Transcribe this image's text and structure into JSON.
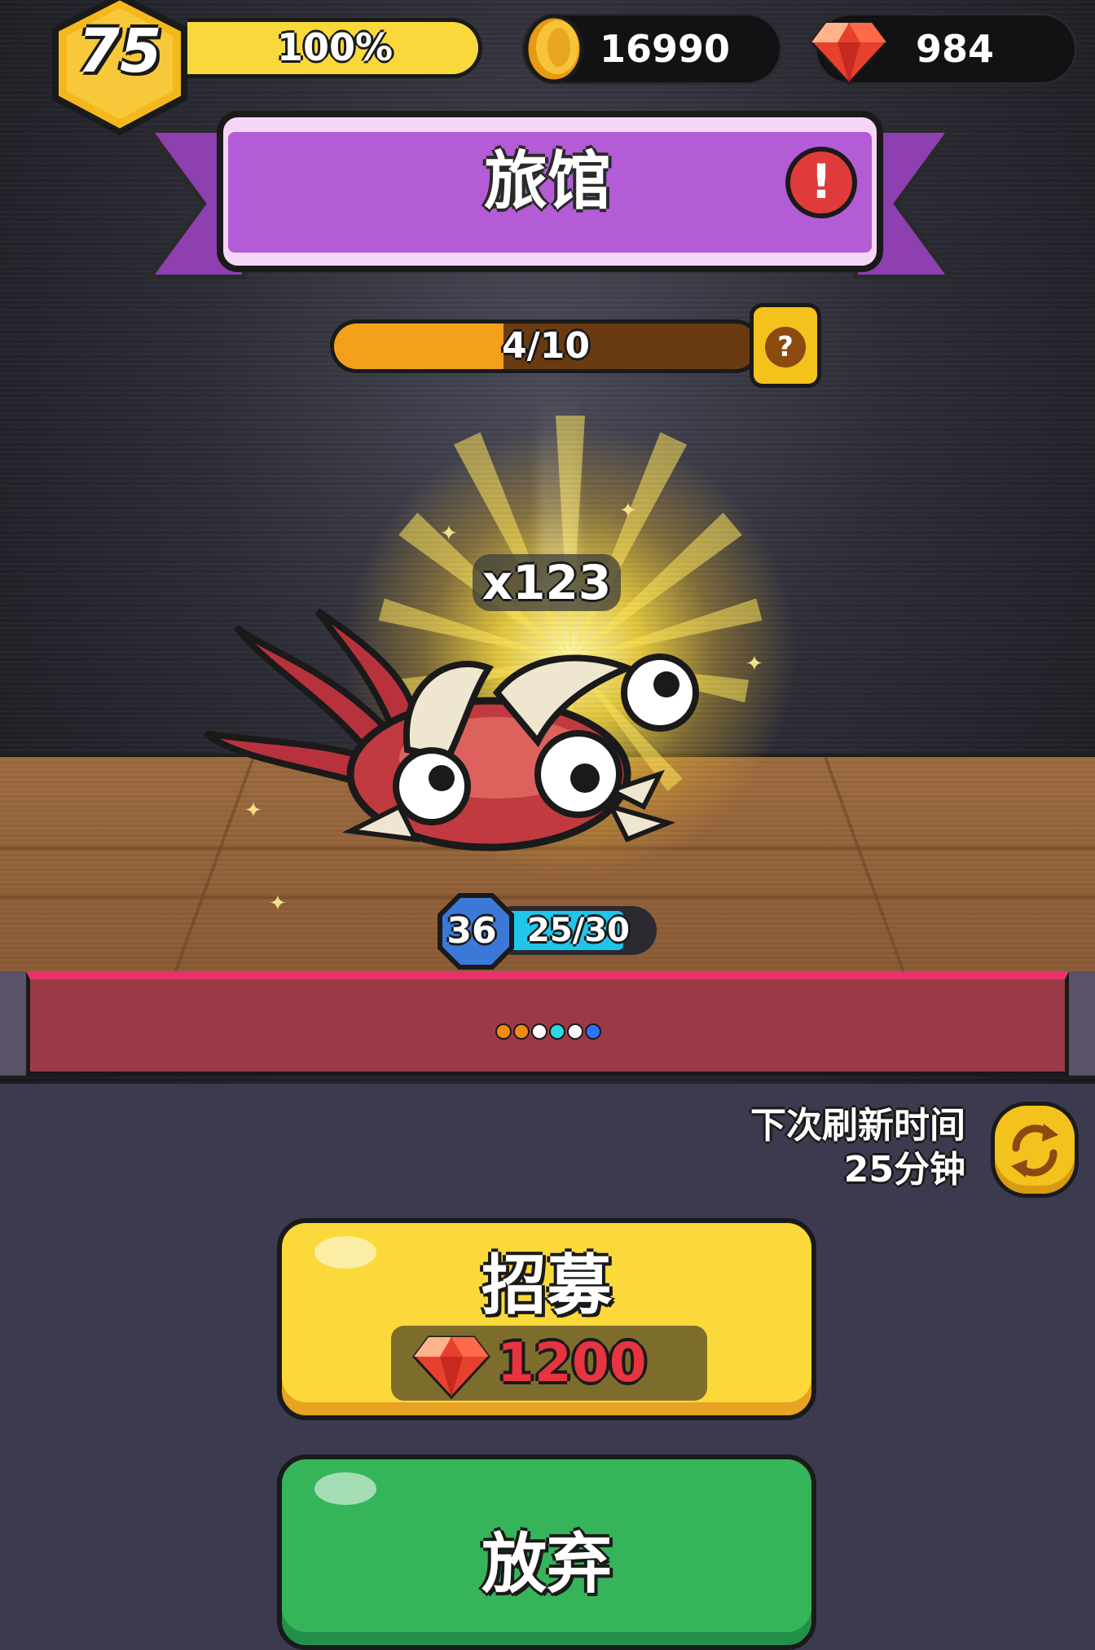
{
  "hud": {
    "player_level": "75",
    "xp_percent_label": "100%",
    "xp_fill": 1.0,
    "coins": "16990",
    "gems": "984",
    "icons": {
      "coin": "coin-icon",
      "gem": "gem-icon"
    }
  },
  "header": {
    "title": "旅馆",
    "alert_symbol": "!"
  },
  "progress": {
    "label": "4/10",
    "current": 4,
    "max": 10,
    "help_symbol": "?"
  },
  "unit": {
    "count_label": "x123",
    "level": "36",
    "hp_label": "25/30",
    "hp_current": 25,
    "hp_max": 30,
    "dots": [
      "#f08a14",
      "#f08a14",
      "#ffffff",
      "#30d5e6",
      "#ffffff",
      "#2d74ff"
    ]
  },
  "refresh": {
    "line1": "下次刷新时间",
    "line2": "25分钟"
  },
  "actions": {
    "recruit_label": "招募",
    "recruit_price": "1200",
    "abandon_label": "放弃"
  },
  "colors": {
    "ribbon_purple": "#b35cd6",
    "xp_yellow": "#f9d83b",
    "recruit_yellow": "#fbd93a",
    "abandon_green": "#35b45a",
    "stage_red": "#9b3a46",
    "hp_cyan": "#1fc6ea"
  }
}
